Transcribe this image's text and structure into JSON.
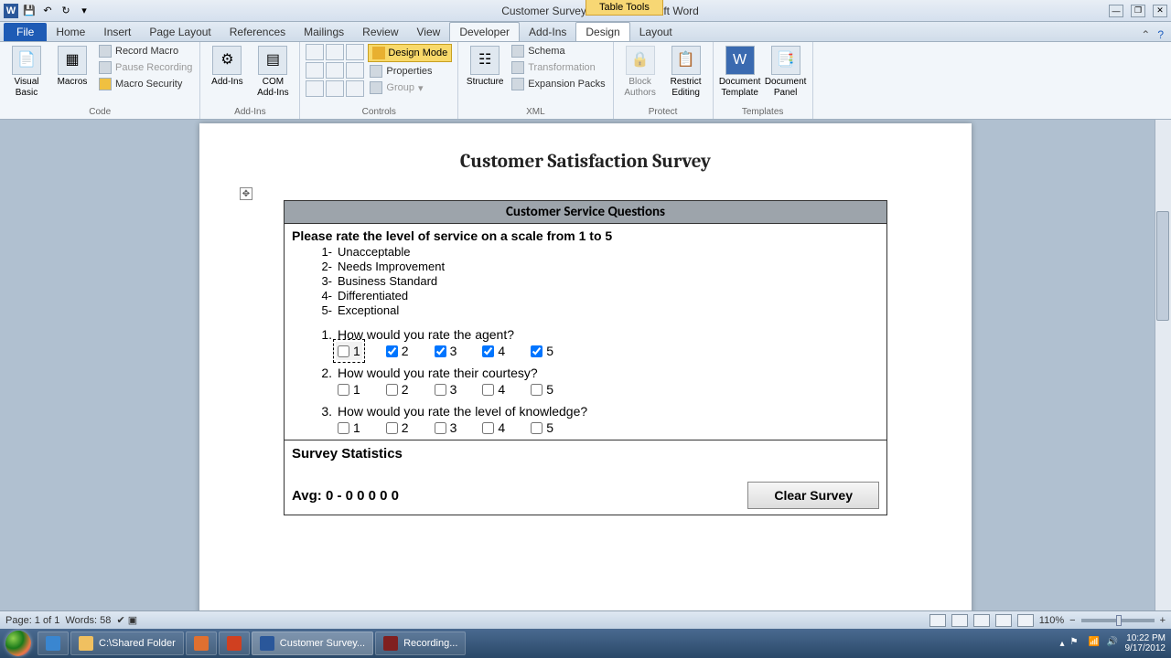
{
  "titlebar": {
    "doc_title": "Customer Survey.docm - Microsoft Word",
    "table_tools": "Table Tools"
  },
  "tabs": {
    "file": "File",
    "items": [
      "Home",
      "Insert",
      "Page Layout",
      "References",
      "Mailings",
      "Review",
      "View",
      "Developer",
      "Add-Ins",
      "Design",
      "Layout"
    ],
    "active_index": 7
  },
  "ribbon": {
    "code": {
      "label": "Code",
      "visual_basic": "Visual\nBasic",
      "macros": "Macros",
      "record": "Record Macro",
      "pause": "Pause Recording",
      "security": "Macro Security"
    },
    "addins": {
      "label": "Add-Ins",
      "addins": "Add-Ins",
      "com": "COM\nAdd-Ins"
    },
    "controls": {
      "label": "Controls",
      "design_mode": "Design Mode",
      "properties": "Properties",
      "group": "Group"
    },
    "xml": {
      "label": "XML",
      "structure": "Structure",
      "schema": "Schema",
      "transformation": "Transformation",
      "expansion": "Expansion Packs"
    },
    "protect": {
      "label": "Protect",
      "block": "Block\nAuthors",
      "restrict": "Restrict\nEditing"
    },
    "templates": {
      "label": "Templates",
      "template": "Document\nTemplate",
      "panel": "Document\nPanel"
    }
  },
  "document": {
    "title": "Customer Satisfaction Survey",
    "table_header": "Customer Service Questions",
    "rate_prompt": "Please rate the level of service on a scale from 1 to 5",
    "scale": [
      {
        "n": "1-",
        "t": "Unacceptable"
      },
      {
        "n": "2-",
        "t": "Needs Improvement"
      },
      {
        "n": "3-",
        "t": "Business Standard"
      },
      {
        "n": "4-",
        "t": "Differentiated"
      },
      {
        "n": "5-",
        "t": "Exceptional"
      }
    ],
    "questions": [
      {
        "n": "1.",
        "t": "How would you rate the agent?",
        "checked": [
          false,
          true,
          true,
          true,
          true
        ],
        "selected": 0
      },
      {
        "n": "2.",
        "t": "How would you rate their courtesy?",
        "checked": [
          false,
          false,
          false,
          false,
          false
        ],
        "selected": -1
      },
      {
        "n": "3.",
        "t": "How would you rate the level of knowledge?",
        "checked": [
          false,
          false,
          false,
          false,
          false
        ],
        "selected": -1
      }
    ],
    "option_labels": [
      "1",
      "2",
      "3",
      "4",
      "5"
    ],
    "stats_header": "Survey Statistics",
    "avg_label": "Avg: 0 - 0 0 0 0 0",
    "clear_button": "Clear Survey"
  },
  "statusbar": {
    "page": "Page: 1 of 1",
    "words": "Words: 58",
    "zoom": "110%"
  },
  "taskbar": {
    "items": [
      {
        "label": ""
      },
      {
        "label": ""
      },
      {
        "label": "C:\\Shared Folder"
      },
      {
        "label": ""
      },
      {
        "label": ""
      },
      {
        "label": "Customer Survey..."
      },
      {
        "label": "Recording..."
      }
    ],
    "time": "10:22 PM",
    "date": "9/17/2012"
  }
}
